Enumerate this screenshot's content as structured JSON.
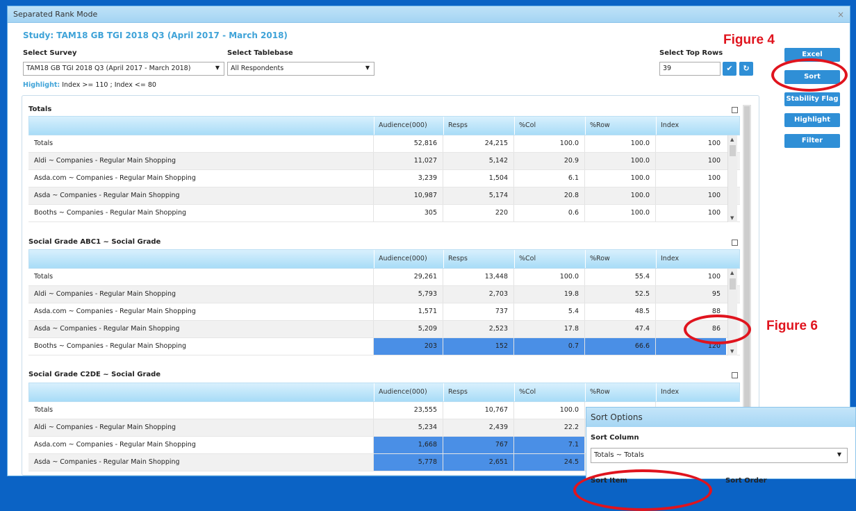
{
  "window": {
    "title": "Separated Rank Mode",
    "close": "×"
  },
  "study": "Study: TAM18 GB TGI 2018 Q3 (April 2017 - March 2018)",
  "survey": {
    "label": "Select Survey",
    "value": "TAM18 GB TGI 2018 Q3 (April 2017 - March 2018)"
  },
  "tablebase": {
    "label": "Select Tablebase",
    "value": "All Respondents"
  },
  "top_rows": {
    "label": "Select Top Rows",
    "value": "39",
    "confirm_icon": "check-icon",
    "refresh_icon": "refresh-icon"
  },
  "highlight": {
    "key": "Highlight:",
    "rule": "Index >= 110 ; Index <= 80"
  },
  "side_buttons": [
    "Excel",
    "Sort",
    "Stability Flag",
    "Highlight",
    "Filter"
  ],
  "annotations": {
    "figure4": "Figure 4",
    "figure6": "Figure 6"
  },
  "columns": [
    "Audience(000)",
    "Resps",
    "%Col",
    "%Row",
    "Index"
  ],
  "sections": [
    {
      "title": "Totals",
      "rows": [
        {
          "name": "Totals",
          "values": [
            "52,816",
            "24,215",
            "100.0",
            "100.0",
            "100"
          ],
          "hi": false
        },
        {
          "name": "Aldi ~ Companies - Regular Main Shopping",
          "values": [
            "11,027",
            "5,142",
            "20.9",
            "100.0",
            "100"
          ],
          "hi": false
        },
        {
          "name": "Asda.com ~ Companies - Regular Main Shopping",
          "values": [
            "3,239",
            "1,504",
            "6.1",
            "100.0",
            "100"
          ],
          "hi": false
        },
        {
          "name": "Asda ~ Companies - Regular Main Shopping",
          "values": [
            "10,987",
            "5,174",
            "20.8",
            "100.0",
            "100"
          ],
          "hi": false
        },
        {
          "name": "Booths ~ Companies - Regular Main Shopping",
          "values": [
            "305",
            "220",
            "0.6",
            "100.0",
            "100"
          ],
          "hi": false
        }
      ]
    },
    {
      "title": "Social Grade ABC1 ~ Social Grade",
      "rows": [
        {
          "name": "Totals",
          "values": [
            "29,261",
            "13,448",
            "100.0",
            "55.4",
            "100"
          ],
          "hi": false
        },
        {
          "name": "Aldi ~ Companies - Regular Main Shopping",
          "values": [
            "5,793",
            "2,703",
            "19.8",
            "52.5",
            "95"
          ],
          "hi": false
        },
        {
          "name": "Asda.com ~ Companies - Regular Main Shopping",
          "values": [
            "1,571",
            "737",
            "5.4",
            "48.5",
            "88"
          ],
          "hi": false
        },
        {
          "name": "Asda ~ Companies - Regular Main Shopping",
          "values": [
            "5,209",
            "2,523",
            "17.8",
            "47.4",
            "86"
          ],
          "hi": false
        },
        {
          "name": "Booths ~ Companies - Regular Main Shopping",
          "values": [
            "203",
            "152",
            "0.7",
            "66.6",
            "120"
          ],
          "hi": true
        }
      ]
    },
    {
      "title": "Social Grade C2DE ~ Social Grade",
      "rows": [
        {
          "name": "Totals",
          "values": [
            "23,555",
            "10,767",
            "100.0",
            "",
            ""
          ],
          "hi": false
        },
        {
          "name": "Aldi ~ Companies - Regular Main Shopping",
          "values": [
            "5,234",
            "2,439",
            "22.2",
            "",
            ""
          ],
          "hi": false
        },
        {
          "name": "Asda.com ~ Companies - Regular Main Shopping",
          "values": [
            "1,668",
            "767",
            "7.1",
            "",
            ""
          ],
          "hi": true
        },
        {
          "name": "Asda ~ Companies - Regular Main Shopping",
          "values": [
            "5,778",
            "2,651",
            "24.5",
            "",
            ""
          ],
          "hi": true
        }
      ]
    }
  ],
  "sort_popup": {
    "title": "Sort Options",
    "column_label": "Sort Column",
    "column_value": "Totals ~ Totals",
    "item_label": "Sort Item",
    "order_label": "Sort Order"
  },
  "colors": {
    "accent": "#2f8fd6",
    "highlight_cell": "#4a8fe6",
    "annotation": "#e0141e",
    "frame": "#0b63c5"
  }
}
